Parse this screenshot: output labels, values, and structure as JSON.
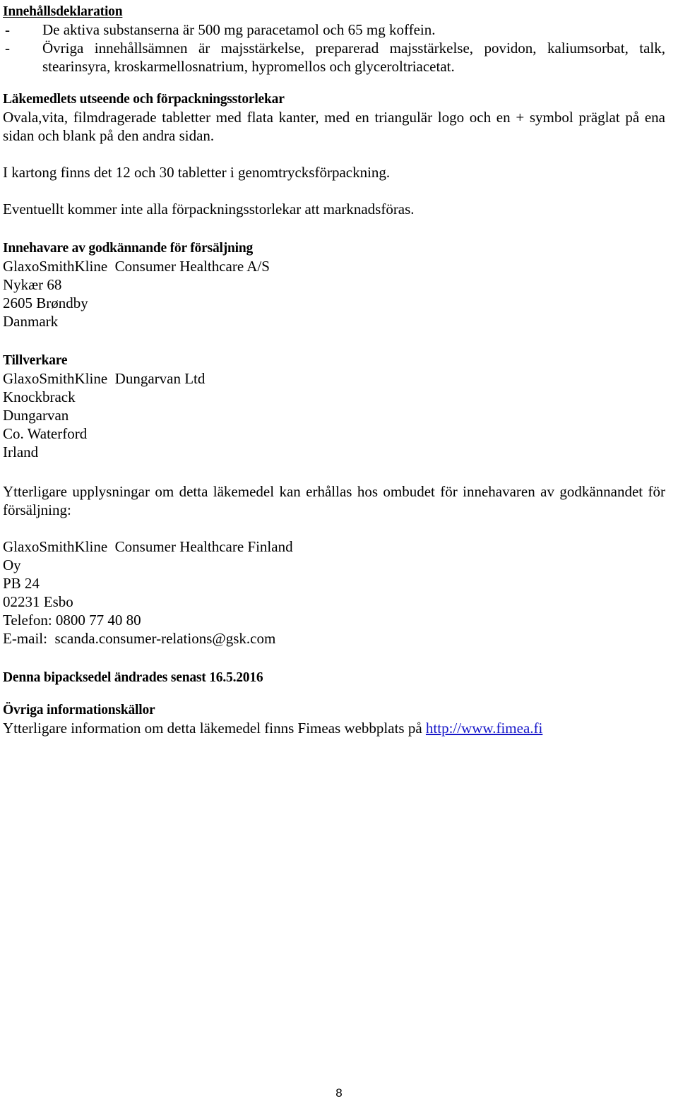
{
  "document": {
    "page_number": "8",
    "link_color": "#1414c8",
    "text_color": "#000000",
    "background_color": "#ffffff"
  },
  "ingredients_section": {
    "heading": "Innehållsdeklaration",
    "bullet_marker": "-",
    "items": [
      "De aktiva substanserna är 500 mg paracetamol och 65 mg koffein.",
      "Övriga innehållsämnen är majsstärkelse, preparerad majsstärkelse, povidon, kaliumsorbat, talk, stearinsyra, kroskarmellosnatrium, hypromellos och glyceroltriacetat."
    ]
  },
  "appearance_section": {
    "heading": "Läkemedlets utseende och förpackningsstorlekar",
    "paragraphs": [
      "Ovala,vita, filmdragerade tabletter med flata kanter, med en triangulär logo och en + symbol präglat på ena sidan och blank på den andra sidan.",
      "I kartong finns det 12 och 30 tabletter i genomtrycksförpackning.",
      "Eventuellt kommer inte alla förpackningsstorlekar att marknadsföras."
    ]
  },
  "marketing_authorisation_holder": {
    "heading": "Innehavare av godkännande för försäljning",
    "address_lines": [
      "GlaxoSmithKline  Consumer Healthcare A/S",
      "Nykær 68",
      "2605 Brøndby",
      "Danmark"
    ]
  },
  "manufacturer": {
    "heading": "Tillverkare",
    "address_lines": [
      "GlaxoSmithKline  Dungarvan Ltd",
      "Knockbrack",
      "Dungarvan",
      "Co. Waterford",
      "Irland"
    ]
  },
  "local_representative": {
    "intro": "Ytterligare upplysningar  om detta läkemedel kan erhållas hos ombudet för innehavaren av godkännandet för försäljning:",
    "address_lines": [
      "GlaxoSmithKline  Consumer Healthcare Finland",
      "Oy",
      "PB 24",
      "02231 Esbo",
      "Telefon: 0800 77 40 80",
      "E-mail:  scanda.consumer-relations@gsk.com"
    ]
  },
  "revision_section": {
    "heading": "Denna bipacksedel ändrades senast 16.5.2016"
  },
  "other_sources_section": {
    "heading": "Övriga informationskällor",
    "text_before_link": "Ytterligare information  om detta läkemedel finns Fimeas webbplats på ",
    "link_text": "http://www.fimea.fi"
  }
}
